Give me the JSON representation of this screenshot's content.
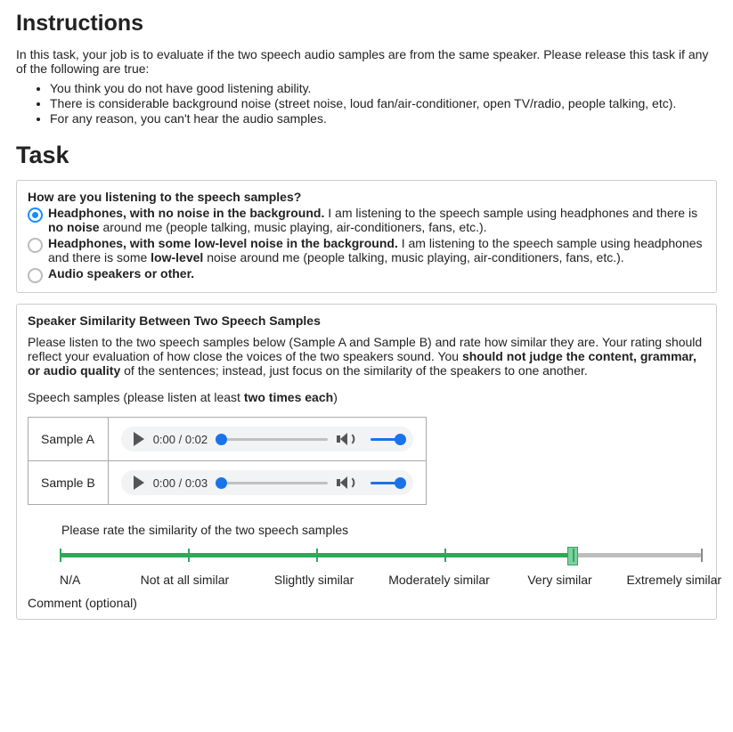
{
  "instructions": {
    "heading": "Instructions",
    "intro": "In this task, your job is to evaluate if the two speech audio samples are from the same speaker. Please release this task if any of the following are true:",
    "release_conditions": [
      "You think you do not have good listening ability.",
      "There is considerable background noise (street noise, loud fan/air-conditioner, open TV/radio, people talking, etc).",
      "For any reason, you can't hear the audio samples."
    ]
  },
  "task": {
    "heading": "Task",
    "listening_question": "How are you listening to the speech samples?",
    "options": {
      "opt1_bold": "Headphones, with no noise in the background.",
      "opt1_rest_a": " I am listening to the speech sample using headphones and there is ",
      "opt1_rest_b": "no noise",
      "opt1_rest_c": " around me (people talking, music playing, air-conditioners, fans, etc.).",
      "opt2_bold": "Headphones, with some low-level noise in the background.",
      "opt2_rest_a": " I am listening to the speech sample using headphones and there is some ",
      "opt2_rest_b": "low-level",
      "opt2_rest_c": " noise around me (people talking, music playing, air-conditioners, fans, etc.).",
      "opt3_bold": "Audio speakers or other."
    },
    "similarity": {
      "title": "Speaker Similarity Between Two Speech Samples",
      "desc_a": "Please listen to the two speech samples below (Sample A and Sample B) and rate how similar they are. Your rating should reflect your evaluation of how close the voices of the two speakers sound. You ",
      "desc_bold": "should not judge the content, grammar, or audio quality",
      "desc_b": " of the sentences; instead, just focus on the similarity of the speakers to one another.",
      "listen_prompt_a": "Speech samples (please listen at least ",
      "listen_prompt_bold": "two times each",
      "listen_prompt_b": ")",
      "sample_a_label": "Sample A",
      "sample_b_label": "Sample B",
      "player_a_time": "0:00 / 0:02",
      "player_b_time": "0:00 / 0:03",
      "slider_prompt": "Please rate the similarity of the two speech samples",
      "scale_labels": [
        "N/A",
        "Not at all similar",
        "Slightly similar",
        "Moderately similar",
        "Very similar",
        "Extremely similar"
      ],
      "slider_value": 4,
      "slider_max": 5,
      "comment_label": "Comment (optional)"
    }
  }
}
